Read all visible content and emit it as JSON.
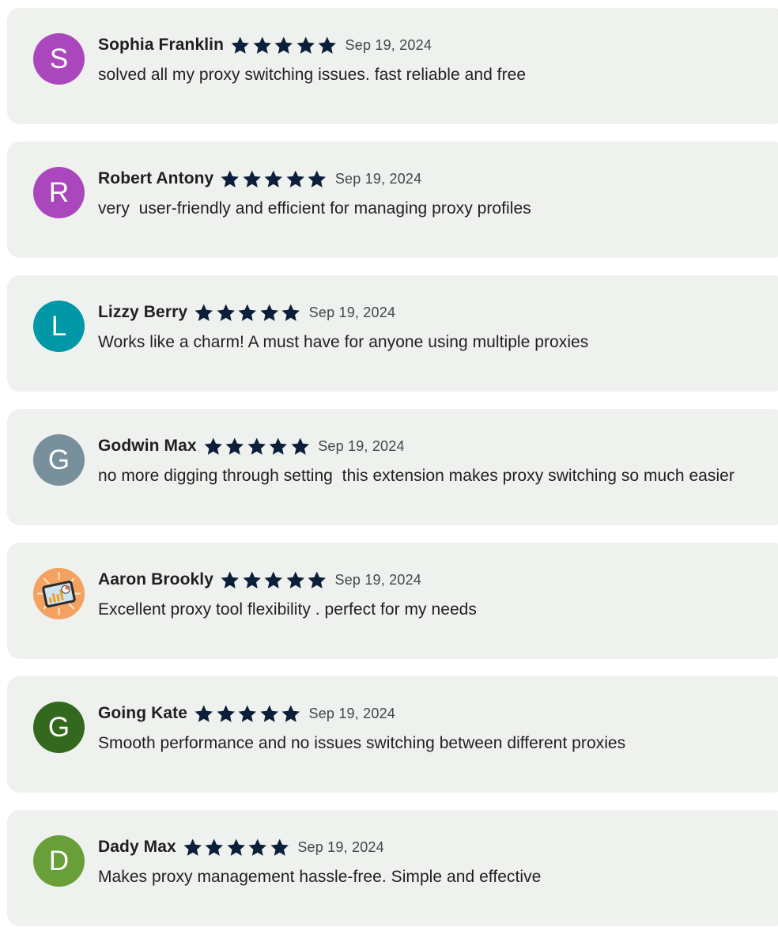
{
  "reviews": [
    {
      "author": "Sophia Franklin",
      "initial": "S",
      "avatar_color": "#ab47bc",
      "rating": 5,
      "date": "Sep 19, 2024",
      "text": "solved all my proxy switching issues. fast reliable and free"
    },
    {
      "author": "Robert Antony",
      "initial": "R",
      "avatar_color": "#ab47bc",
      "rating": 5,
      "date": "Sep 19, 2024",
      "text": "very  user-friendly and efficient for managing proxy profiles"
    },
    {
      "author": "Lizzy Berry",
      "initial": "L",
      "avatar_color": "#0097a7",
      "rating": 5,
      "date": "Sep 19, 2024",
      "text": "Works like a charm! A must have for anyone using multiple proxies"
    },
    {
      "author": "Godwin Max",
      "initial": "G",
      "avatar_color": "#78909c",
      "rating": 5,
      "date": "Sep 19, 2024",
      "text": "no more digging through setting  this extension makes proxy switching so much easier"
    },
    {
      "author": "Aaron Brookly",
      "initial": "",
      "avatar_icon": "tablet-chart-illustration-icon",
      "avatar_color": "#f4a261",
      "rating": 5,
      "date": "Sep 19, 2024",
      "text": "Excellent proxy tool flexibility . perfect for my needs"
    },
    {
      "author": "Going Kate",
      "initial": "G",
      "avatar_color": "#33691e",
      "rating": 5,
      "date": "Sep 19, 2024",
      "text": "Smooth performance and no issues switching between different proxies"
    },
    {
      "author": "Dady Max",
      "initial": "D",
      "avatar_color": "#689f38",
      "rating": 5,
      "date": "Sep 19, 2024",
      "text": "Makes proxy management hassle-free. Simple and effective"
    }
  ],
  "star_icon": "star-icon",
  "star_color": "#0b1f3a"
}
